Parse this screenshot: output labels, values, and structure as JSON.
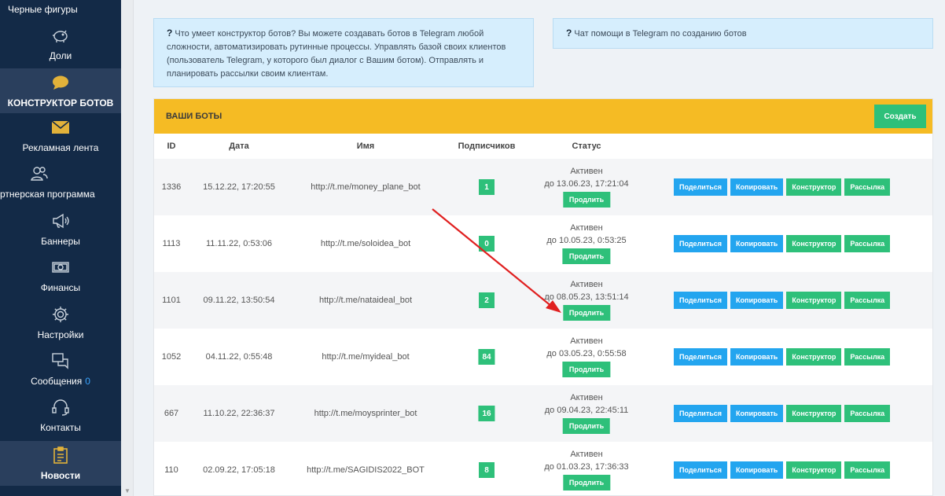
{
  "sidebar": {
    "items": [
      {
        "label": "Черные фигуры",
        "icon": "none"
      },
      {
        "label": "Доли",
        "icon": "piggy-bank-icon"
      },
      {
        "label": "КОНСТРУКТОР БОТОВ",
        "icon": "chat-bubble-icon",
        "active": true
      },
      {
        "label": "Рекламная лента",
        "icon": "envelope-icon"
      },
      {
        "label": "ртнерская программа",
        "icon": "users-icon"
      },
      {
        "label": "Баннеры",
        "icon": "megaphone-icon"
      },
      {
        "label": "Финансы",
        "icon": "money-icon"
      },
      {
        "label": "Настройки",
        "icon": "gear-icon"
      },
      {
        "label": "Сообщения",
        "icon": "messages-icon",
        "count": "0"
      },
      {
        "label": "Контакты",
        "icon": "headset-icon"
      },
      {
        "label": "Новости",
        "icon": "clipboard-icon",
        "active": true
      }
    ]
  },
  "info_left": {
    "q": "?",
    "text": " Что умеет конструктор ботов? Вы можете создавать ботов в Telegram любой сложности, автоматизировать рутинные процессы. Управлять базой своих клиентов (пользователь Telegram, у которого был диалог с Вашим ботом). Отправлять и планировать рассылки своим клиентам."
  },
  "info_right": {
    "q": "?",
    "text": " Чат помощи в Telegram по созданию ботов"
  },
  "panel": {
    "title": "ВАШИ БОТЫ",
    "create_label": "Создать",
    "columns": {
      "id": "ID",
      "date": "Дата",
      "name": "Имя",
      "subs": "Подписчиков",
      "status": "Статус"
    },
    "rows": [
      {
        "id": "1336",
        "date": "15.12.22, 17:20:55",
        "name": "http://t.me/money_plane_bot",
        "subs": "1",
        "status": "Активен",
        "until": "до 13.06.23, 17:21:04"
      },
      {
        "id": "1113",
        "date": "11.11.22, 0:53:06",
        "name": "http://t.me/soloidea_bot",
        "subs": "0",
        "status": "Активен",
        "until": "до 10.05.23, 0:53:25"
      },
      {
        "id": "1101",
        "date": "09.11.22, 13:50:54",
        "name": "http://t.me/nataideal_bot",
        "subs": "2",
        "status": "Активен",
        "until": "до 08.05.23, 13:51:14"
      },
      {
        "id": "1052",
        "date": "04.11.22, 0:55:48",
        "name": "http://t.me/myideal_bot",
        "subs": "84",
        "status": "Активен",
        "until": "до 03.05.23, 0:55:58"
      },
      {
        "id": "667",
        "date": "11.10.22, 22:36:37",
        "name": "http://t.me/moysprinter_bot",
        "subs": "16",
        "status": "Активен",
        "until": "до 09.04.23, 22:45:11"
      },
      {
        "id": "110",
        "date": "02.09.22, 17:05:18",
        "name": "http://t.me/SAGIDIS2022_BOT",
        "subs": "8",
        "status": "Активен",
        "until": "до 01.03.23, 17:36:33"
      }
    ],
    "labels": {
      "extend": "Продлить",
      "share": "Поделиться",
      "copy": "Копировать",
      "constructor": "Конструктор",
      "mailing": "Рассылка"
    }
  },
  "colors": {
    "sidebar": "#132a47",
    "panel_header": "#f5bb24",
    "green": "#2ec07a",
    "blue": "#23a5ef",
    "arrow": "#e02020"
  }
}
